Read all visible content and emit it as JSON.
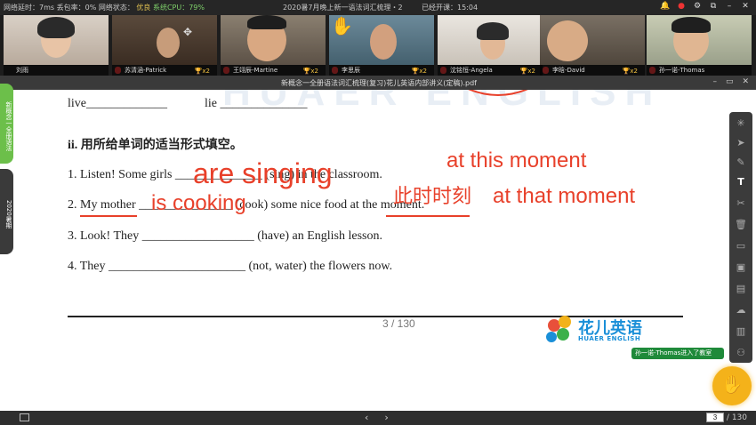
{
  "status_bar": {
    "network_latency": "网络延时：7ms",
    "packet_loss": "丢包率：0%",
    "network_status_label": "网络状态：",
    "network_status_value": "优良",
    "cpu": "系统CPU：79%",
    "class_title": "2020暑7月晚上新一语法词汇梳理・2",
    "class_started": "已经开课：15:04"
  },
  "participants": [
    {
      "name": "刘雨"
    },
    {
      "name": "苏清涵-Patrick",
      "badge": "x2"
    },
    {
      "name": "王翊辰-Martine",
      "badge": "x2"
    },
    {
      "name": "李思辰",
      "badge": "x2"
    },
    {
      "name": "沈铭恒-Angela",
      "badge": "x2"
    },
    {
      "name": "李晗-David",
      "badge": "x2"
    },
    {
      "name": "孙一诺-Thomas"
    }
  ],
  "document": {
    "filename": "新概念一全册语法词汇梳理(复习)花儿英语内部讲义(定稿).pdf",
    "watermark": "HUAER ENGLISH",
    "line_live": "live_____________",
    "line_lie": "lie ______________",
    "section_heading": "ii. 用所给单词的适当形式填空。",
    "q1": "1. Listen! Some girls ______________ (sing) in the classroom.",
    "q2_prefix": "2. My mother _______________ (cook) some nice food at the moment.",
    "q3": "3. Look! They __________________ (have) an English lesson.",
    "q4": "4. They ______________________ (not, water) the flowers now.",
    "page_indicator": "3  /  130",
    "logo_cn": "花儿英语",
    "logo_en": "HUAER ENGLISH"
  },
  "annotations": {
    "a1": "are singing",
    "a2": "is cooking",
    "a3": "at this moment",
    "a4": "此时时刻",
    "a5": "at that moment"
  },
  "side_tabs": {
    "tab1": "新概念一全册语法",
    "tab2": "2020暑期"
  },
  "notification": "孙一诺-Thomas进入了教室",
  "hand_label": "举手",
  "bottom_bar": {
    "prev": "‹",
    "next": "›",
    "current_page": "3",
    "total_pages": "/ 130"
  },
  "colors": {
    "annotation_red": "#e8402a",
    "logo_blue": "#1a8fd8",
    "hand_yellow": "#f4b21a"
  }
}
